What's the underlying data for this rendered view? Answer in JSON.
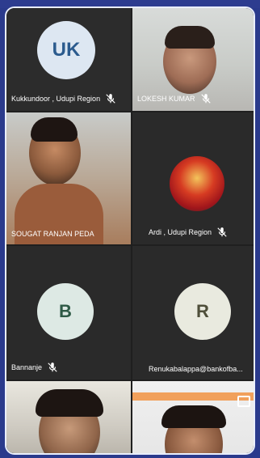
{
  "participants": [
    {
      "id": "kukkundoor",
      "initials": "UK",
      "name": "Kukkundoor , Udupi Region",
      "muted": true
    },
    {
      "id": "lokesh",
      "name": "LOKESH KUMAR",
      "muted": true
    },
    {
      "id": "sougat",
      "name": "SOUGAT RANJAN PEDA",
      "muted": false
    },
    {
      "id": "ardi",
      "name": "Ardi , Udupi Region",
      "muted": true
    },
    {
      "id": "bannanje",
      "initials": "B",
      "name": "Bannanje",
      "muted": true
    },
    {
      "id": "renuka",
      "initials": "R",
      "name": "Renukabalappa@bankofba...",
      "muted": false
    }
  ],
  "colors": {
    "tile_bg": "#2a2a2a",
    "label_text": "#ffffff",
    "frame": "#2a3a8c"
  },
  "icons": {
    "muted": "mic-off-icon",
    "chat": "chat-icon"
  }
}
